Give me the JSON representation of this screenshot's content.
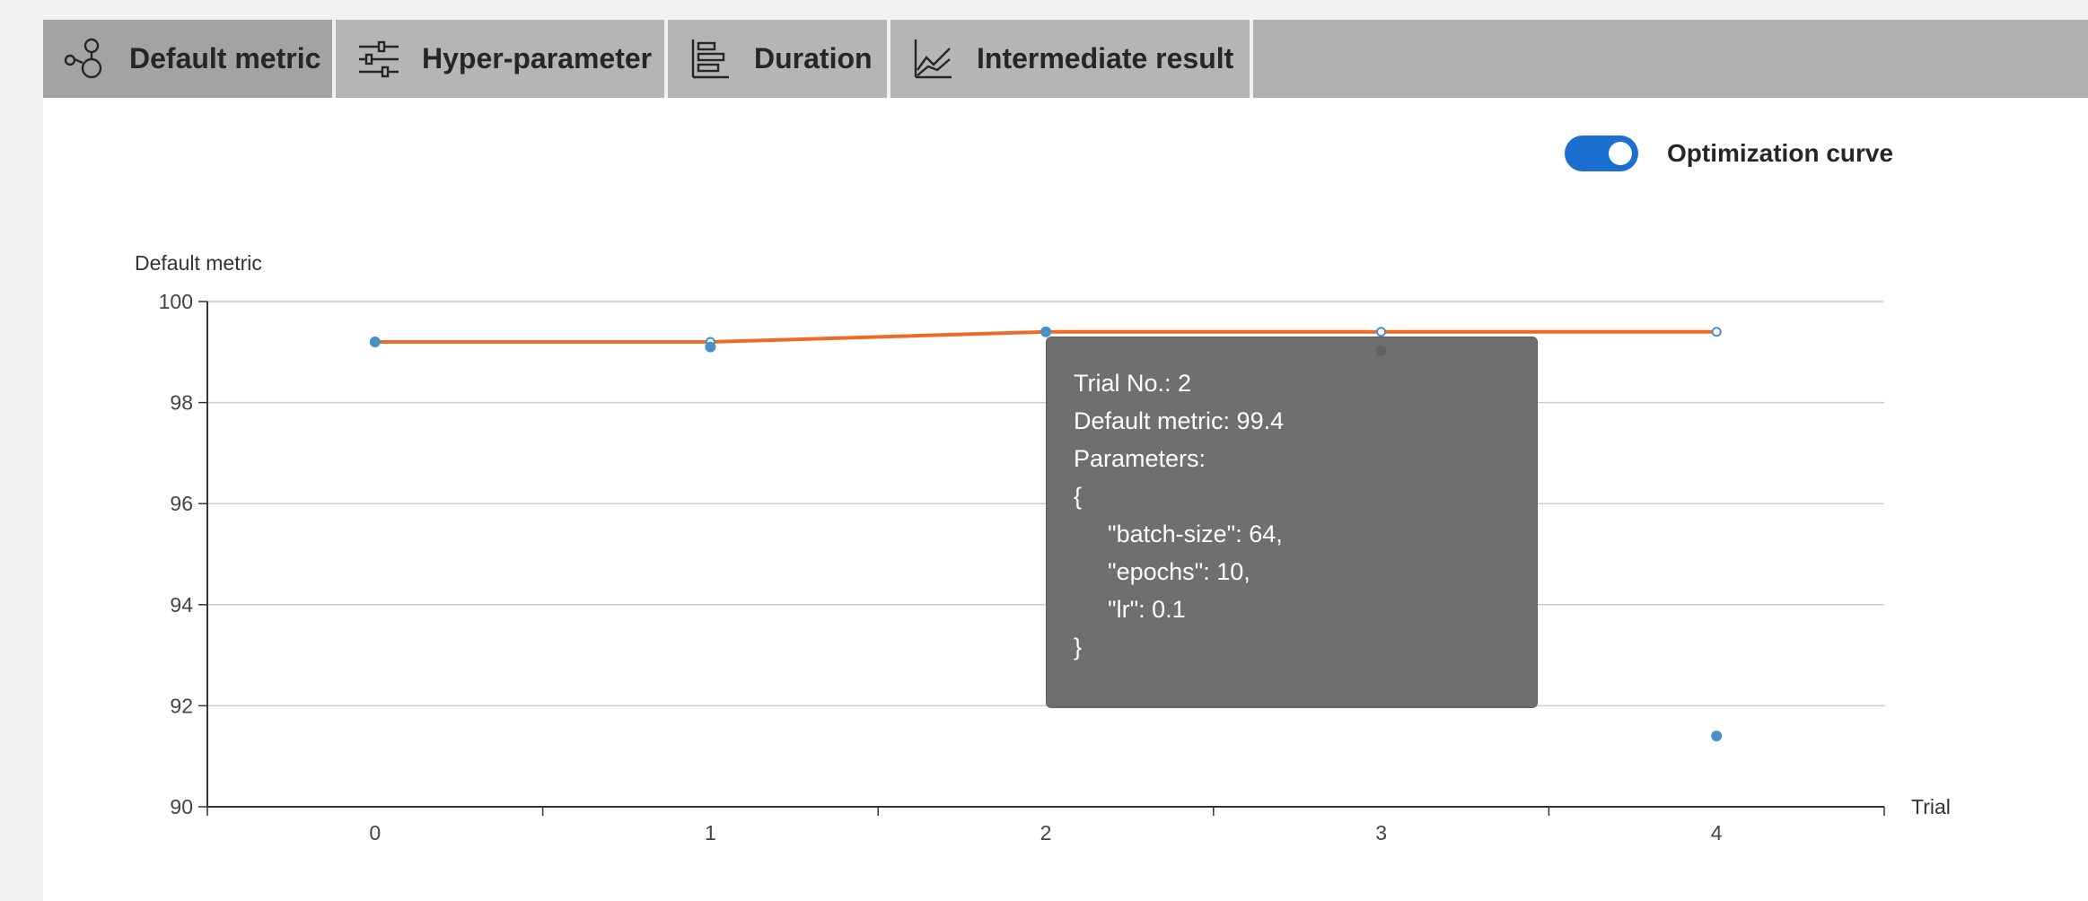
{
  "tabs": [
    {
      "label": "Default metric",
      "icon": "nodes-icon",
      "active": true
    },
    {
      "label": "Hyper-parameter",
      "icon": "sliders-icon",
      "active": false
    },
    {
      "label": "Duration",
      "icon": "bar-chart-icon",
      "active": false
    },
    {
      "label": "Intermediate result",
      "icon": "line-chart-icon",
      "active": false
    }
  ],
  "toggle": {
    "label": "Optimization curve",
    "on": true,
    "color": "#1a6fd1"
  },
  "colors": {
    "curve": "#f06a25",
    "point": "#4a90c8",
    "dark_point": "#333f48",
    "grid": "#cccccc"
  },
  "chart_data": {
    "type": "scatter",
    "ylabel": "Default metric",
    "xlabel": "Trial",
    "ylim": [
      90,
      100
    ],
    "yticks": [
      90,
      92,
      94,
      96,
      98,
      100
    ],
    "xticks": [
      0,
      1,
      2,
      3,
      4
    ],
    "grid": true,
    "series": [
      {
        "values": [
          {
            "x": 0,
            "y": 99.2
          },
          {
            "x": 1,
            "y": 99.1
          },
          {
            "x": 2,
            "y": 99.4
          },
          {
            "x": 3,
            "y": 99.15
          },
          {
            "x": 4,
            "y": 91.4
          }
        ]
      },
      {
        "line": true,
        "values": [
          {
            "x": 0,
            "y": 99.2
          },
          {
            "x": 1,
            "y": 99.2
          },
          {
            "x": 2,
            "y": 99.4
          },
          {
            "x": 3,
            "y": 99.4
          },
          {
            "x": 4,
            "y": 99.4
          }
        ]
      }
    ]
  },
  "tooltip": {
    "trial": "Trial No.: 2",
    "metric": "Default metric: 99.4",
    "params_label": "Parameters:",
    "open": "{",
    "p1": "\"batch-size\": 64,",
    "p2": "\"epochs\": 10,",
    "p3": "\"lr\": 0.1",
    "close": "}"
  }
}
